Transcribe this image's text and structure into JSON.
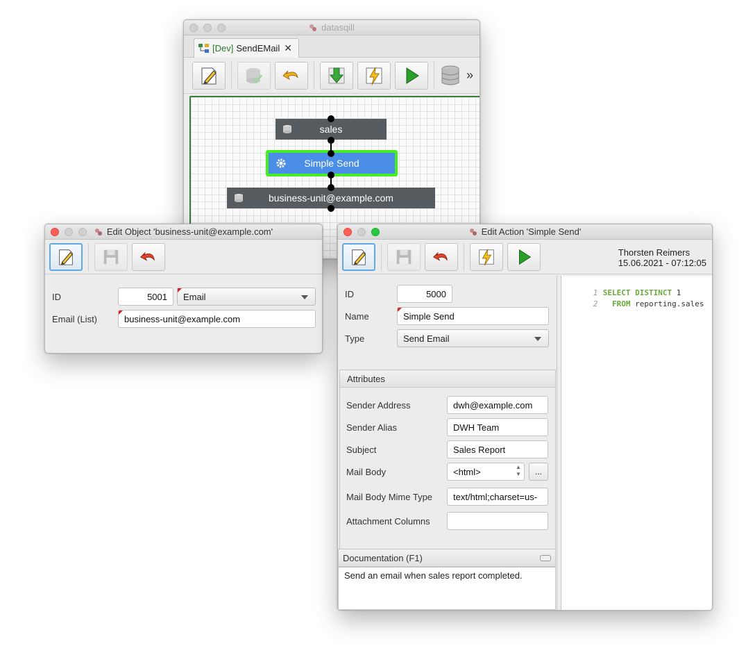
{
  "main_window": {
    "title": "datasqill",
    "tab": {
      "prefix": "[Dev]",
      "name": "SendEMail",
      "close": "✕"
    },
    "toolbar": {
      "edit_icon": "pencil-icon",
      "check_icon": "db-check-icon",
      "undo_icon": "undo-icon",
      "download_icon": "download-arrow-icon",
      "flash_icon": "lightning-icon",
      "run_icon": "play-icon",
      "db_icon": "database-icon",
      "more": "»"
    },
    "graph": {
      "nodes": [
        {
          "label": "sales",
          "icon": "database-icon"
        },
        {
          "label": "Simple Send",
          "icon": "gear-icon"
        },
        {
          "label": "business-unit@example.com",
          "icon": "database-icon"
        }
      ]
    }
  },
  "edit_object": {
    "title": "Edit Object 'business-unit@example.com'",
    "fields": {
      "id_label": "ID",
      "id_value": "5001",
      "type_value": "Email",
      "email_label": "Email (List)",
      "email_value": "business-unit@example.com"
    }
  },
  "edit_action": {
    "title": "Edit Action 'Simple Send'",
    "user_name": "Thorsten Reimers",
    "timestamp": "15.06.2021 - 07:12:05",
    "fields": {
      "id_label": "ID",
      "id_value": "5000",
      "name_label": "Name",
      "name_value": "Simple Send",
      "type_label": "Type",
      "type_value": "Send Email"
    },
    "attributes": {
      "header": "Attributes",
      "rows": [
        {
          "label": "Sender Address",
          "value": "dwh@example.com"
        },
        {
          "label": "Sender Alias",
          "value": "DWH Team"
        },
        {
          "label": "Subject",
          "value": "Sales Report"
        },
        {
          "label": "Mail Body",
          "value": "<html>"
        },
        {
          "label": "Mail Body Mime Type",
          "value": "text/html;charset=us-"
        },
        {
          "label": "Attachment Columns",
          "value": ""
        }
      ],
      "ellipsis_button": "..."
    },
    "documentation": {
      "header": "Documentation (F1)",
      "text": "Send an email when sales report completed."
    },
    "code": {
      "lines": [
        {
          "num": "1",
          "keyword": "SELECT DISTINCT",
          "rest": " 1"
        },
        {
          "num": "2",
          "keyword": "  FROM",
          "rest": " reporting.sales"
        }
      ]
    }
  },
  "colors": {
    "selected_node_fill": "#4a8ee8",
    "selected_node_border": "#44ee22",
    "node_fill": "#555b5f",
    "sql_keyword": "#6aaa3a"
  }
}
